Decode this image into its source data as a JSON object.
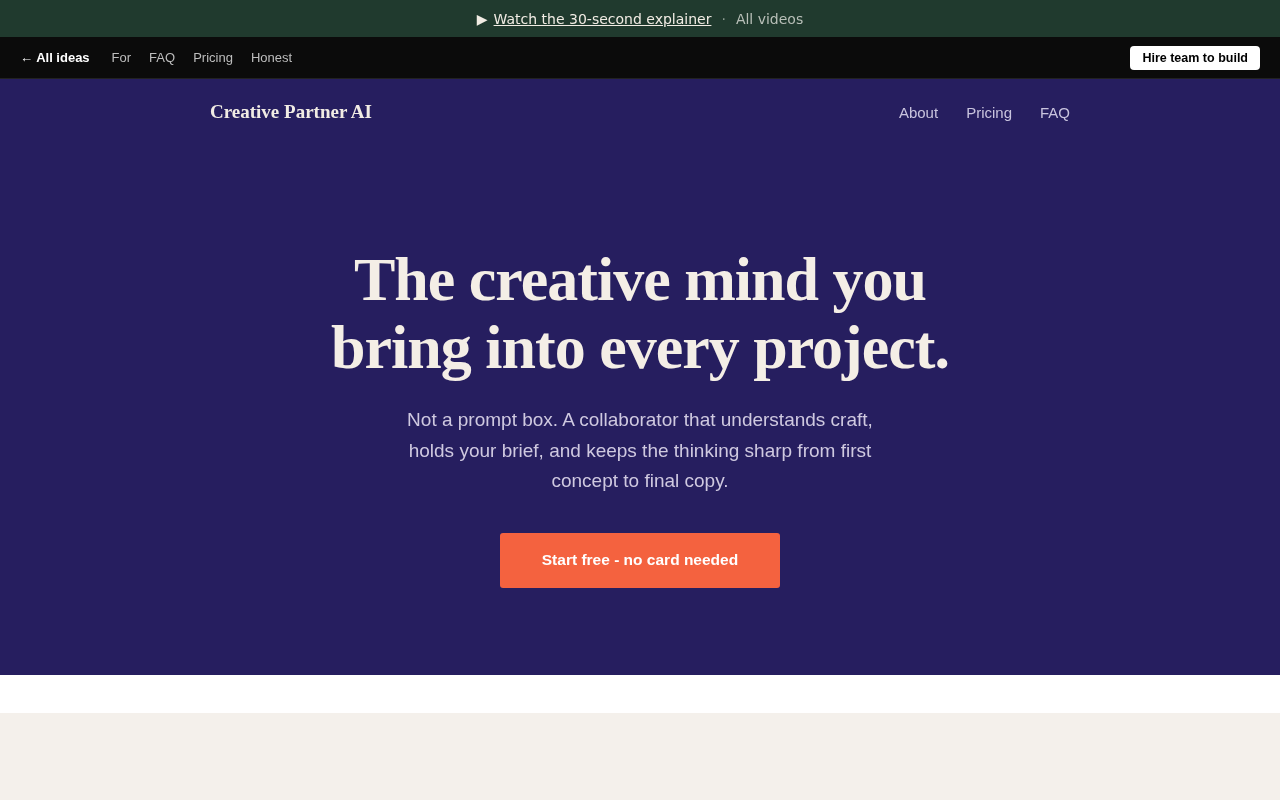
{
  "banner": {
    "play": "▶",
    "link": "Watch the 30-second explainer",
    "separator": "·",
    "secondary": "All videos"
  },
  "topnav": {
    "back": "← All ideas",
    "links": [
      "For",
      "FAQ",
      "Pricing",
      "Honest"
    ],
    "cta": "Hire team to build"
  },
  "site_header": {
    "brand": "Creative Partner AI",
    "links": [
      "About",
      "Pricing",
      "FAQ"
    ]
  },
  "hero": {
    "headline_lines": [
      "The creative mind you",
      "bring into every project."
    ],
    "subtitle": "Not a prompt box. A collaborator that understands craft, holds your brief, and keeps the thinking sharp from first concept to final copy.",
    "cta": "Start free - no card needed"
  }
}
